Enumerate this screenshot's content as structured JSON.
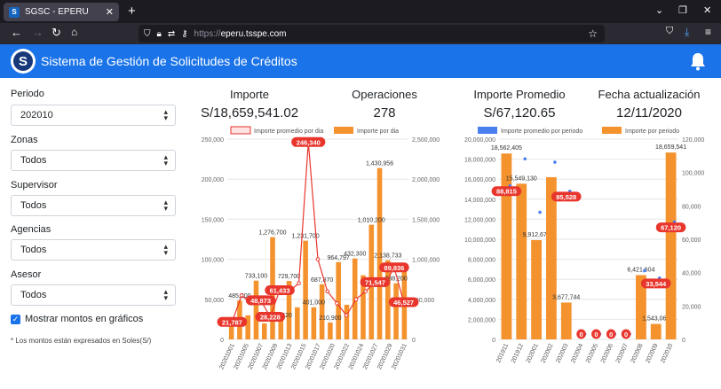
{
  "browser": {
    "tab_title": "SGSC - EPERU",
    "url_protocol": "https://",
    "url_host": "eperu.tsspe.com"
  },
  "header": {
    "title": "Sistema de Gestión de Solicitudes de Créditos",
    "logo_letter": "S"
  },
  "filters": {
    "periodo": {
      "label": "Periodo",
      "value": "202010"
    },
    "zonas": {
      "label": "Zonas",
      "value": "Todos"
    },
    "supervisor": {
      "label": "Supervisor",
      "value": "Todos"
    },
    "agencias": {
      "label": "Agencias",
      "value": "Todos"
    },
    "asesor": {
      "label": "Asesor",
      "value": "Todos"
    }
  },
  "show_amounts": {
    "label": "Mostrar montos en gráficos",
    "checked": true
  },
  "footnote": "* Los montos están expresados en Soles(S/)",
  "kpis": {
    "importe": {
      "title": "Importe",
      "value": "S/18,659,541.02"
    },
    "operaciones": {
      "title": "Operaciones",
      "value": "278"
    },
    "importe_promedio": {
      "title": "Importe Promedio",
      "value": "S/67,120.65"
    },
    "fecha": {
      "title": "Fecha actualización",
      "value": "12/11/2020"
    }
  },
  "chart_data": [
    {
      "type": "bar",
      "legend": [
        "Importe promedio por dia",
        "Importe por dia"
      ],
      "colors": {
        "bar": "#f4922e",
        "line": "#e8362d"
      },
      "x": [
        "20201001",
        "20201005",
        "20201007",
        "20201009",
        "20201013",
        "20201015",
        "20201017",
        "20201020",
        "20201022",
        "20201024",
        "20201027",
        "20201029",
        "20201031"
      ],
      "left_axis": {
        "ticks": [
          "0",
          "50,000",
          "100,000",
          "150,000",
          "200,000",
          "250,000"
        ],
        "range": [
          0,
          250000
        ]
      },
      "right_axis": {
        "ticks": [
          "0",
          "500,000",
          "1,000,000",
          "1,500,000",
          "2,000,000",
          "2,500,000"
        ],
        "range": [
          0,
          2500000
        ]
      },
      "series": [
        {
          "name": "Importe por dia",
          "axis": "right",
          "values": [
            174800,
            485200,
            300000,
            733100,
            200000,
            1276700,
            243400,
            729700,
            400000,
            1231700,
            401000,
            687870,
            210900,
            964797,
            432300,
            1010200,
            800000,
            1430956,
            2138733,
            988200,
            700000,
            890000
          ]
        },
        {
          "name": "Importe promedio por dia",
          "axis": "left",
          "values": [
            21787,
            55000,
            45000,
            48873,
            28228,
            61433,
            60000,
            70000,
            246340,
            100000,
            60000,
            45000,
            30000,
            50000,
            60000,
            71547,
            68000,
            89836,
            46527
          ]
        }
      ],
      "bar_labels": [
        "174,800",
        "485,200",
        "733,100",
        "1,276,700",
        "243,420",
        "729,700",
        "1,231,700",
        "401,000",
        "687,870",
        "210,900",
        "964,797",
        "432,300",
        "1,010,200",
        "1,430,956",
        "2,138,733",
        "988,200"
      ],
      "line_labels": [
        "21,787",
        "48,873",
        "28,228",
        "61,433",
        "246,340",
        "71,547",
        "89,836",
        "46,527"
      ]
    },
    {
      "type": "bar",
      "legend": [
        "Importe promedio por periodo",
        "Importe por periodo"
      ],
      "colors": {
        "bar": "#f4922e",
        "point": "#4a7ff0",
        "label": "#e8362d"
      },
      "x": [
        "201911",
        "201912",
        "202001",
        "202002",
        "202003",
        "202004",
        "202005",
        "202006",
        "202007",
        "202008",
        "202009",
        "202010"
      ],
      "left_axis": {
        "ticks": [
          "0",
          "2,000,000",
          "4,000,000",
          "6,000,000",
          "8,000,000",
          "10,000,000",
          "12,000,000",
          "14,000,000",
          "16,000,000",
          "18,000,000",
          "20,000,000"
        ],
        "range": [
          0,
          20000000
        ]
      },
      "right_axis": {
        "ticks": [
          "0",
          "20,000",
          "40,000",
          "60,000",
          "80,000",
          "100,000",
          "120,000"
        ],
        "range": [
          0,
          120000
        ]
      },
      "series": [
        {
          "name": "Importe por periodo",
          "axis": "left",
          "values": [
            18562405,
            15549130,
            9912676,
            16200000,
            3677744,
            0,
            0,
            0,
            0,
            6421604,
            1543065,
            18659541
          ]
        },
        {
          "name": "Importe promedio por periodo",
          "axis": "right",
          "values": [
            88815,
            105000,
            73000,
            103000,
            85528,
            0,
            0,
            0,
            0,
            38000,
            33544,
            67120
          ]
        }
      ],
      "bar_labels": [
        "18,562,405",
        "15,549,130",
        "9,912,676",
        "",
        "3,677,744",
        "0",
        "0",
        "0",
        "0",
        "6,421,604",
        "1,543,065",
        "18,659,541"
      ],
      "point_labels": [
        "88,815",
        "",
        "",
        "",
        "85,528",
        "0",
        "0",
        "0",
        "0",
        "",
        "33,544",
        "67,120"
      ]
    }
  ]
}
